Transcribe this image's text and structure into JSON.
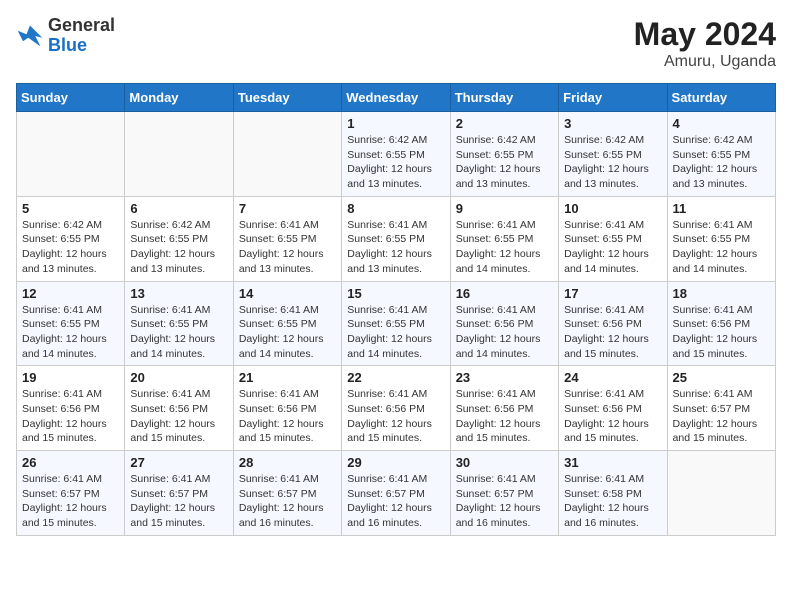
{
  "logo": {
    "general": "General",
    "blue": "Blue"
  },
  "title": {
    "month_year": "May 2024",
    "location": "Amuru, Uganda"
  },
  "days_of_week": [
    "Sunday",
    "Monday",
    "Tuesday",
    "Wednesday",
    "Thursday",
    "Friday",
    "Saturday"
  ],
  "weeks": [
    [
      {
        "day": "",
        "info": ""
      },
      {
        "day": "",
        "info": ""
      },
      {
        "day": "",
        "info": ""
      },
      {
        "day": "1",
        "info": "Sunrise: 6:42 AM\nSunset: 6:55 PM\nDaylight: 12 hours and 13 minutes."
      },
      {
        "day": "2",
        "info": "Sunrise: 6:42 AM\nSunset: 6:55 PM\nDaylight: 12 hours and 13 minutes."
      },
      {
        "day": "3",
        "info": "Sunrise: 6:42 AM\nSunset: 6:55 PM\nDaylight: 12 hours and 13 minutes."
      },
      {
        "day": "4",
        "info": "Sunrise: 6:42 AM\nSunset: 6:55 PM\nDaylight: 12 hours and 13 minutes."
      }
    ],
    [
      {
        "day": "5",
        "info": "Sunrise: 6:42 AM\nSunset: 6:55 PM\nDaylight: 12 hours and 13 minutes."
      },
      {
        "day": "6",
        "info": "Sunrise: 6:42 AM\nSunset: 6:55 PM\nDaylight: 12 hours and 13 minutes."
      },
      {
        "day": "7",
        "info": "Sunrise: 6:41 AM\nSunset: 6:55 PM\nDaylight: 12 hours and 13 minutes."
      },
      {
        "day": "8",
        "info": "Sunrise: 6:41 AM\nSunset: 6:55 PM\nDaylight: 12 hours and 13 minutes."
      },
      {
        "day": "9",
        "info": "Sunrise: 6:41 AM\nSunset: 6:55 PM\nDaylight: 12 hours and 14 minutes."
      },
      {
        "day": "10",
        "info": "Sunrise: 6:41 AM\nSunset: 6:55 PM\nDaylight: 12 hours and 14 minutes."
      },
      {
        "day": "11",
        "info": "Sunrise: 6:41 AM\nSunset: 6:55 PM\nDaylight: 12 hours and 14 minutes."
      }
    ],
    [
      {
        "day": "12",
        "info": "Sunrise: 6:41 AM\nSunset: 6:55 PM\nDaylight: 12 hours and 14 minutes."
      },
      {
        "day": "13",
        "info": "Sunrise: 6:41 AM\nSunset: 6:55 PM\nDaylight: 12 hours and 14 minutes."
      },
      {
        "day": "14",
        "info": "Sunrise: 6:41 AM\nSunset: 6:55 PM\nDaylight: 12 hours and 14 minutes."
      },
      {
        "day": "15",
        "info": "Sunrise: 6:41 AM\nSunset: 6:55 PM\nDaylight: 12 hours and 14 minutes."
      },
      {
        "day": "16",
        "info": "Sunrise: 6:41 AM\nSunset: 6:56 PM\nDaylight: 12 hours and 14 minutes."
      },
      {
        "day": "17",
        "info": "Sunrise: 6:41 AM\nSunset: 6:56 PM\nDaylight: 12 hours and 15 minutes."
      },
      {
        "day": "18",
        "info": "Sunrise: 6:41 AM\nSunset: 6:56 PM\nDaylight: 12 hours and 15 minutes."
      }
    ],
    [
      {
        "day": "19",
        "info": "Sunrise: 6:41 AM\nSunset: 6:56 PM\nDaylight: 12 hours and 15 minutes."
      },
      {
        "day": "20",
        "info": "Sunrise: 6:41 AM\nSunset: 6:56 PM\nDaylight: 12 hours and 15 minutes."
      },
      {
        "day": "21",
        "info": "Sunrise: 6:41 AM\nSunset: 6:56 PM\nDaylight: 12 hours and 15 minutes."
      },
      {
        "day": "22",
        "info": "Sunrise: 6:41 AM\nSunset: 6:56 PM\nDaylight: 12 hours and 15 minutes."
      },
      {
        "day": "23",
        "info": "Sunrise: 6:41 AM\nSunset: 6:56 PM\nDaylight: 12 hours and 15 minutes."
      },
      {
        "day": "24",
        "info": "Sunrise: 6:41 AM\nSunset: 6:56 PM\nDaylight: 12 hours and 15 minutes."
      },
      {
        "day": "25",
        "info": "Sunrise: 6:41 AM\nSunset: 6:57 PM\nDaylight: 12 hours and 15 minutes."
      }
    ],
    [
      {
        "day": "26",
        "info": "Sunrise: 6:41 AM\nSunset: 6:57 PM\nDaylight: 12 hours and 15 minutes."
      },
      {
        "day": "27",
        "info": "Sunrise: 6:41 AM\nSunset: 6:57 PM\nDaylight: 12 hours and 15 minutes."
      },
      {
        "day": "28",
        "info": "Sunrise: 6:41 AM\nSunset: 6:57 PM\nDaylight: 12 hours and 16 minutes."
      },
      {
        "day": "29",
        "info": "Sunrise: 6:41 AM\nSunset: 6:57 PM\nDaylight: 12 hours and 16 minutes."
      },
      {
        "day": "30",
        "info": "Sunrise: 6:41 AM\nSunset: 6:57 PM\nDaylight: 12 hours and 16 minutes."
      },
      {
        "day": "31",
        "info": "Sunrise: 6:41 AM\nSunset: 6:58 PM\nDaylight: 12 hours and 16 minutes."
      },
      {
        "day": "",
        "info": ""
      }
    ]
  ]
}
